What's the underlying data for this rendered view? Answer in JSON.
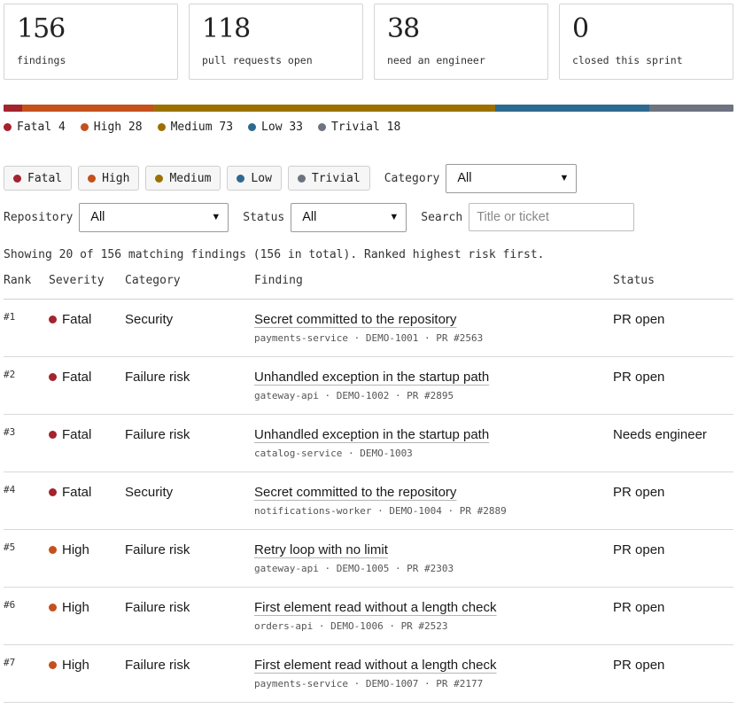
{
  "stats": [
    {
      "value": "156",
      "label": "findings"
    },
    {
      "value": "118",
      "label": "pull requests open"
    },
    {
      "value": "38",
      "label": "need an engineer"
    },
    {
      "value": "0",
      "label": "closed this sprint"
    }
  ],
  "severity_colors": {
    "Fatal": "#a3232e",
    "High": "#c4501c",
    "Medium": "#9c7000",
    "Low": "#2d6a8f",
    "Trivial": "#6e7380"
  },
  "distribution": [
    {
      "name": "Fatal",
      "count": 4,
      "legend": "Fatal 4"
    },
    {
      "name": "High",
      "count": 28,
      "legend": "High 28"
    },
    {
      "name": "Medium",
      "count": 73,
      "legend": "Medium 73"
    },
    {
      "name": "Low",
      "count": 33,
      "legend": "Low 33"
    },
    {
      "name": "Trivial",
      "count": 18,
      "legend": "Trivial 18"
    }
  ],
  "filters": {
    "severity_chips": [
      "Fatal",
      "High",
      "Medium",
      "Low",
      "Trivial"
    ],
    "category_label": "Category",
    "category_value": "All",
    "repository_label": "Repository",
    "repository_value": "All",
    "status_label": "Status",
    "status_value": "All",
    "search_label": "Search",
    "search_placeholder": "Title or ticket"
  },
  "summary": "Showing 20 of 156 matching findings (156 in total). Ranked highest risk first.",
  "table": {
    "headers": {
      "rank": "Rank",
      "severity": "Severity",
      "category": "Category",
      "finding": "Finding",
      "status": "Status"
    },
    "rows": [
      {
        "rank": "#1",
        "severity": "Fatal",
        "category": "Security",
        "title": "Secret committed to the repository",
        "meta": "payments-service · DEMO-1001 · PR #2563",
        "status": "PR open"
      },
      {
        "rank": "#2",
        "severity": "Fatal",
        "category": "Failure risk",
        "title": "Unhandled exception in the startup path",
        "meta": "gateway-api · DEMO-1002 · PR #2895",
        "status": "PR open"
      },
      {
        "rank": "#3",
        "severity": "Fatal",
        "category": "Failure risk",
        "title": "Unhandled exception in the startup path",
        "meta": "catalog-service · DEMO-1003",
        "status": "Needs engineer"
      },
      {
        "rank": "#4",
        "severity": "Fatal",
        "category": "Security",
        "title": "Secret committed to the repository",
        "meta": "notifications-worker · DEMO-1004 · PR #2889",
        "status": "PR open"
      },
      {
        "rank": "#5",
        "severity": "High",
        "category": "Failure risk",
        "title": "Retry loop with no limit",
        "meta": "gateway-api · DEMO-1005 · PR #2303",
        "status": "PR open"
      },
      {
        "rank": "#6",
        "severity": "High",
        "category": "Failure risk",
        "title": "First element read without a length check",
        "meta": "orders-api · DEMO-1006 · PR #2523",
        "status": "PR open"
      },
      {
        "rank": "#7",
        "severity": "High",
        "category": "Failure risk",
        "title": "First element read without a length check",
        "meta": "payments-service · DEMO-1007 · PR #2177",
        "status": "PR open"
      }
    ]
  }
}
